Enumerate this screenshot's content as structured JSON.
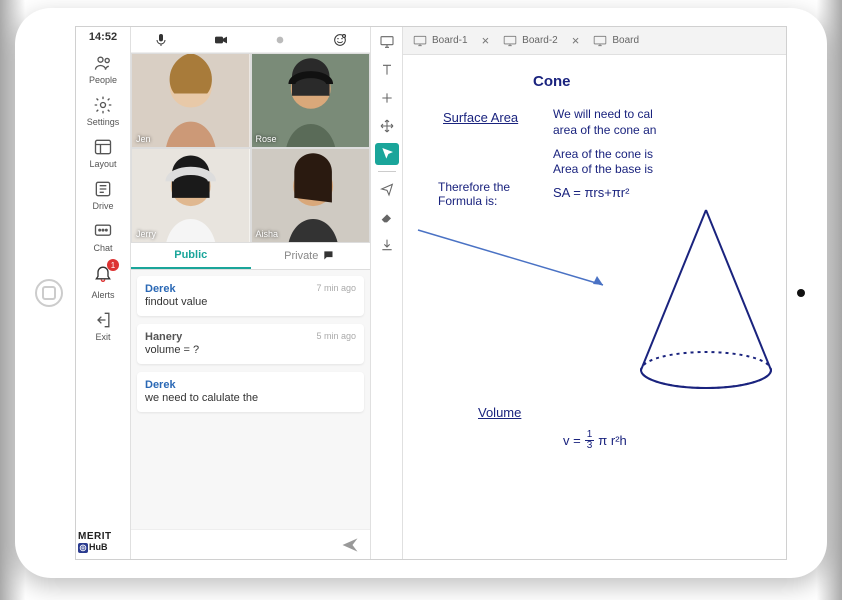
{
  "time": "14:52",
  "brand": {
    "line1": "MERIT",
    "line2": "HuB"
  },
  "nav": [
    {
      "icon": "people",
      "label": "People"
    },
    {
      "icon": "settings",
      "label": "Settings"
    },
    {
      "icon": "layout",
      "label": "Layout"
    },
    {
      "icon": "drive",
      "label": "Drive"
    },
    {
      "icon": "chat",
      "label": "Chat"
    },
    {
      "icon": "alerts",
      "label": "Alerts",
      "badge": 1
    },
    {
      "icon": "exit",
      "label": "Exit"
    }
  ],
  "topbar_icons": [
    "microphone",
    "video-camera",
    "record-dot",
    "emoji-add"
  ],
  "participants": [
    {
      "name": "Jen"
    },
    {
      "name": "Rose"
    },
    {
      "name": "Jerry"
    },
    {
      "name": "Aisha"
    }
  ],
  "chat_tabs": {
    "public": "Public",
    "private": "Private"
  },
  "messages": [
    {
      "author": "Derek",
      "body": "findout value",
      "ts": "7 min ago",
      "highlight": true
    },
    {
      "author": "Hanery",
      "body": "volume  = ?",
      "ts": "5 min ago",
      "highlight": false
    },
    {
      "author": "Derek",
      "body": "we need to calulate the",
      "ts": "",
      "highlight": true
    }
  ],
  "whiteboard_tools": [
    "screen",
    "text",
    "draw-plus",
    "move",
    "pointer",
    "divider",
    "share",
    "eraser",
    "download"
  ],
  "board_tabs": [
    "Board-1",
    "Board-2",
    "Board"
  ],
  "board_content": {
    "title": "Cone",
    "surface_area_label": "Surface\nArea",
    "sa_text1_line1": "We will need to cal",
    "sa_text1_line2": "area of the cone an",
    "sa_text2_line1": "Area of the cone is",
    "sa_text2_line2": "Area of the base is",
    "therefore_line1": "Therefore the",
    "therefore_line2": "Formula is:",
    "formula_sa": "SA = πrs+πr²",
    "volume_label": "Volume",
    "formula_v_prefix": "v =",
    "frac_num": "1",
    "frac_den": "3",
    "formula_v_suffix": "π r²h"
  }
}
